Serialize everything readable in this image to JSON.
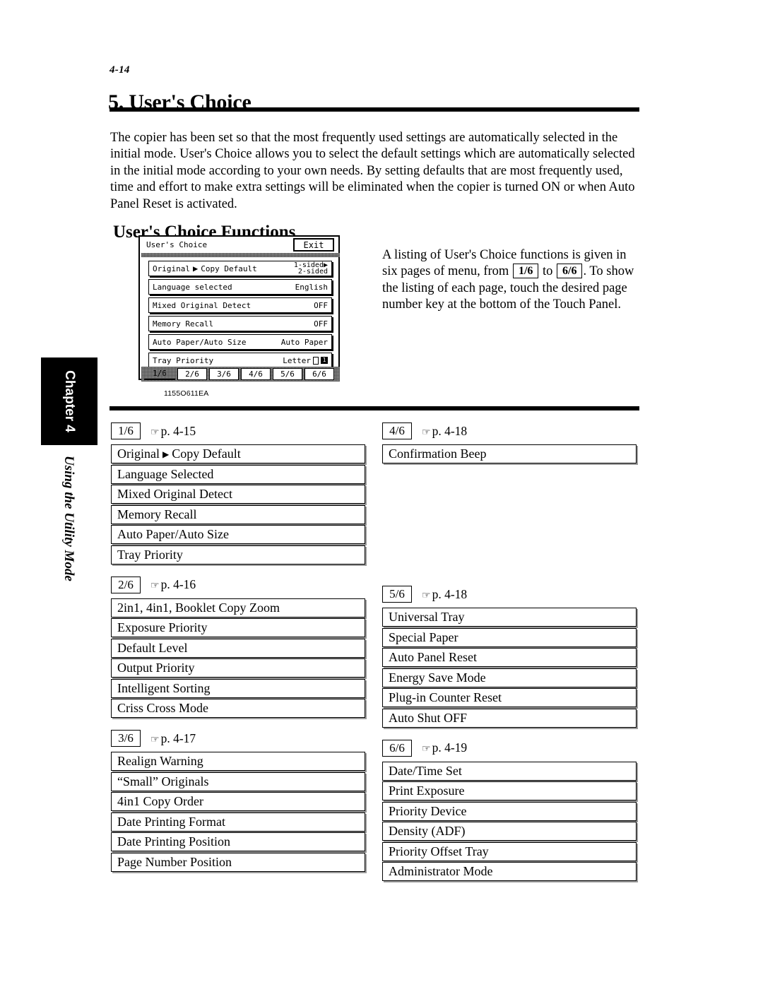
{
  "page_number": "4-14",
  "main_title": "5. User's Choice",
  "intro_paragraph": "The copier has been set so that the most frequently used settings are automatically selected in the initial mode. User's Choice allows you to select the default settings which are automatically selected in the initial mode according to your own needs. By setting defaults that are most frequently used, time and effort to make extra settings will be eliminated when the copier is turned ON or when Auto Panel Reset is activated.",
  "section_title": "User's Choice Functions",
  "sidebar": {
    "chapter_label": "Chapter 4",
    "subtitle": "Using the Utility Mode"
  },
  "figure": {
    "caption": "1155O611EA",
    "lcd": {
      "title": "User's Choice",
      "exit_label": "Exit",
      "rows": [
        {
          "label_a": "Original",
          "arrow": "▶",
          "label_b": "Copy Default",
          "value_line1": "1-sided▶",
          "value_line2": "2-sided",
          "two_line": true
        },
        {
          "label": "Language selected",
          "value": "English"
        },
        {
          "label": "Mixed Original Detect",
          "value": "OFF"
        },
        {
          "label": "Memory Recall",
          "value": "OFF"
        },
        {
          "label": "Auto Paper/Auto Size",
          "value": "Auto Paper"
        },
        {
          "label": "Tray Priority",
          "value": "Letter",
          "has_paper_icon": true,
          "tray_badge": "1"
        }
      ],
      "tabs": [
        {
          "label": "1/6",
          "active": true
        },
        {
          "label": "2/6",
          "active": false
        },
        {
          "label": "3/6",
          "active": false
        },
        {
          "label": "4/6",
          "active": false
        },
        {
          "label": "5/6",
          "active": false
        },
        {
          "label": "6/6",
          "active": false
        }
      ]
    }
  },
  "figure_note": {
    "text_part1": "A listing of User's Choice functions is given in six pages of menu, from",
    "key1": "1/6",
    "text_part2": "to",
    "key2": "6/6",
    "text_part3": ". To show the listing of each page, touch the desired page number key at the bottom of the Touch Panel."
  },
  "pointer_glyph": "☞",
  "groups": [
    {
      "page_key": "1/6",
      "page_ref": "p. 4-15",
      "items": [
        {
          "text": "Original ▶ Copy Default",
          "has_arrow": true,
          "before": "Original",
          "after": "Copy Default"
        },
        {
          "text": "Language Selected"
        },
        {
          "text": "Mixed Original Detect"
        },
        {
          "text": "Memory Recall"
        },
        {
          "text": "Auto Paper/Auto Size"
        },
        {
          "text": "Tray Priority"
        }
      ]
    },
    {
      "page_key": "2/6",
      "page_ref": "p. 4-16",
      "items": [
        {
          "text": "2in1, 4in1, Booklet Copy Zoom"
        },
        {
          "text": "Exposure Priority"
        },
        {
          "text": "Default Level"
        },
        {
          "text": "Output Priority"
        },
        {
          "text": "Intelligent Sorting"
        },
        {
          "text": "Criss Cross Mode"
        }
      ]
    },
    {
      "page_key": "3/6",
      "page_ref": "p. 4-17",
      "items": [
        {
          "text": "Realign Warning"
        },
        {
          "text": "“Small” Originals"
        },
        {
          "text": "4in1 Copy Order"
        },
        {
          "text": "Date Printing Format"
        },
        {
          "text": "Date Printing Position"
        },
        {
          "text": "Page Number Position"
        }
      ]
    },
    {
      "page_key": "4/6",
      "page_ref": "p. 4-18",
      "items": [
        {
          "text": "Confirmation Beep"
        }
      ]
    },
    {
      "page_key": "5/6",
      "page_ref": "p. 4-18",
      "items": [
        {
          "text": "Universal Tray"
        },
        {
          "text": "Special Paper"
        },
        {
          "text": "Auto Panel Reset"
        },
        {
          "text": "Energy Save Mode"
        },
        {
          "text": "Plug-in Counter Reset"
        },
        {
          "text": "Auto Shut OFF"
        }
      ]
    },
    {
      "page_key": "6/6",
      "page_ref": "p. 4-19",
      "items": [
        {
          "text": "Date/Time Set"
        },
        {
          "text": "Print Exposure"
        },
        {
          "text": "Priority Device"
        },
        {
          "text": "Density (ADF)"
        },
        {
          "text": "Priority Offset Tray"
        },
        {
          "text": "Administrator Mode"
        }
      ]
    }
  ],
  "colors": {
    "ink": "#000000",
    "box_shadow": "#9a9a9a",
    "lcd_texture": "#b8b8b8"
  }
}
